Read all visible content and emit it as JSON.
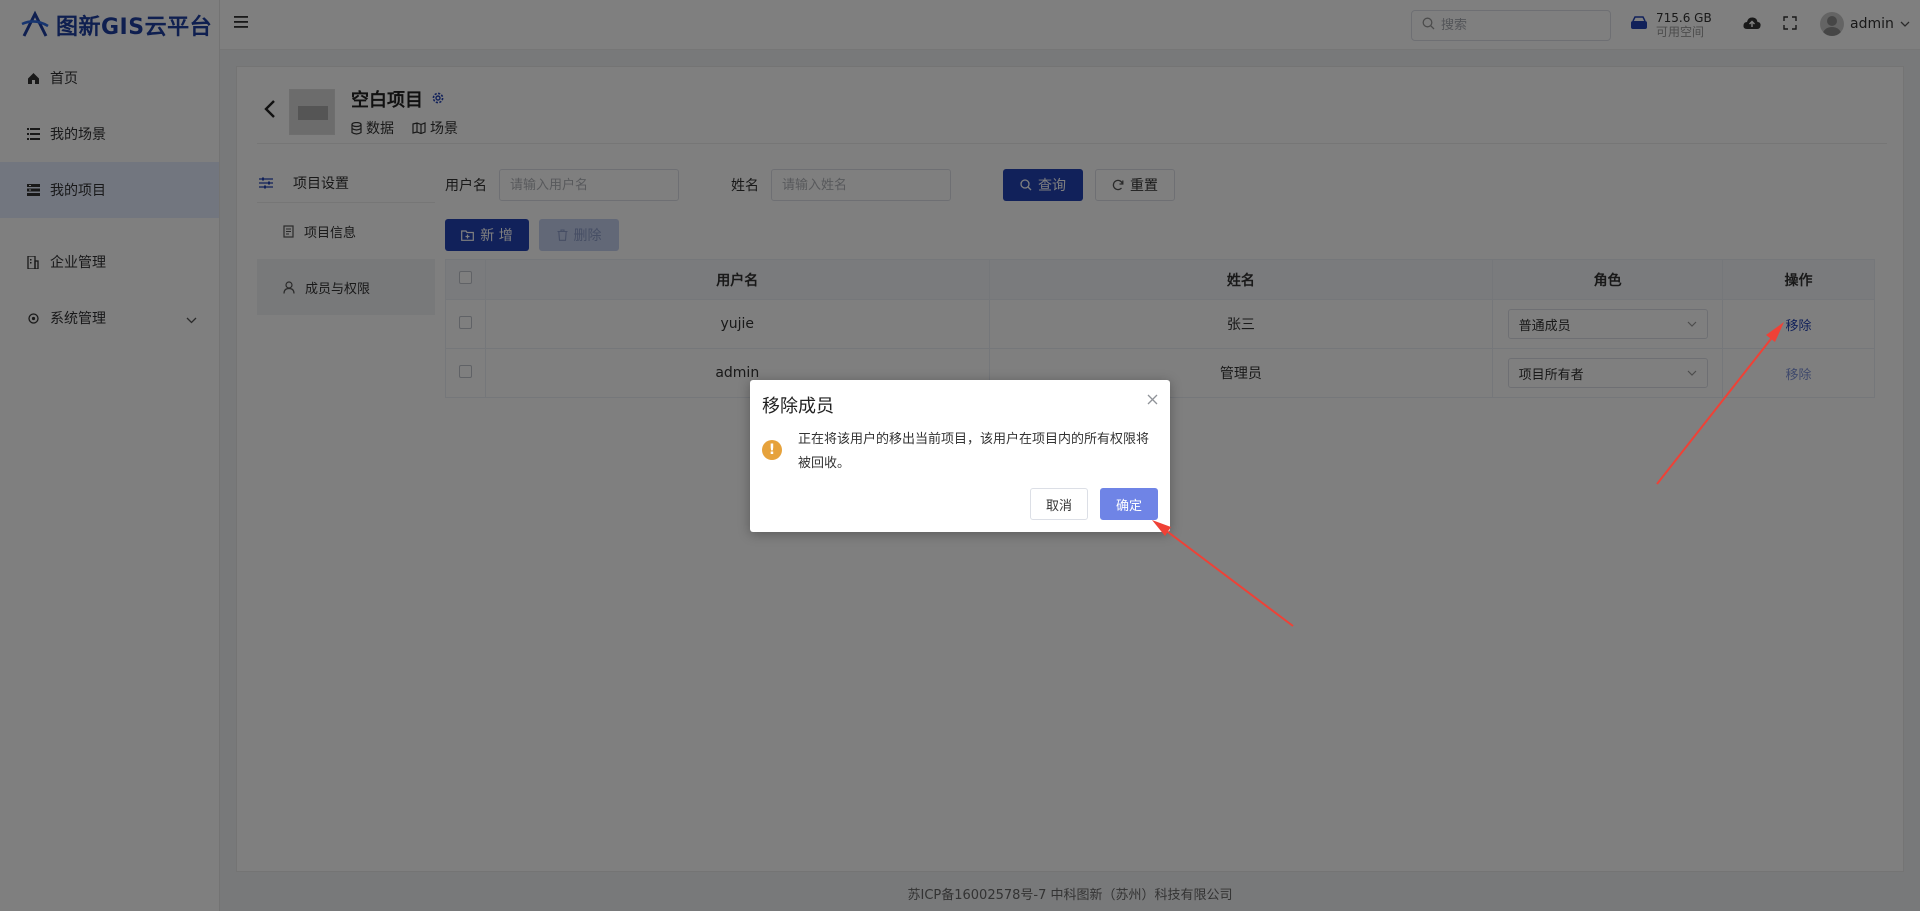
{
  "app": {
    "logo_text": "图新GIS云平台"
  },
  "sidebar": {
    "items": [
      {
        "label": "首页",
        "icon": "home-icon"
      },
      {
        "label": "我的场景",
        "icon": "list-icon"
      },
      {
        "label": "我的项目",
        "icon": "project-icon",
        "active": true
      },
      {
        "label": "企业管理",
        "icon": "building-icon"
      },
      {
        "label": "系统管理",
        "icon": "settings-icon",
        "has_children": true
      }
    ]
  },
  "header": {
    "search_placeholder": "搜索",
    "storage_value": "715.6 GB",
    "storage_label": "可用空间",
    "user_name": "admin"
  },
  "project": {
    "title": "空白项目",
    "link_data": "数据",
    "link_scene": "场景"
  },
  "subnav": {
    "header": "项目设置",
    "items": [
      {
        "label": "项目信息"
      },
      {
        "label": "成员与权限",
        "active": true
      }
    ]
  },
  "filters": {
    "username_label": "用户名",
    "username_placeholder": "请输入用户名",
    "name_label": "姓名",
    "name_placeholder": "请输入姓名",
    "query_label": "查询",
    "reset_label": "重置"
  },
  "actions": {
    "add_label": "新 增",
    "delete_label": "删除"
  },
  "table": {
    "headers": [
      "用户名",
      "姓名",
      "角色",
      "操作"
    ],
    "rows": [
      {
        "username": "yujie",
        "name": "张三",
        "role": "普通成员",
        "action": "移除"
      },
      {
        "username": "admin",
        "name": "管理员",
        "role": "项目所有者",
        "action": "移除"
      }
    ]
  },
  "footer": {
    "text": "苏ICP备16002578号-7 中科图新（苏州）科技有限公司"
  },
  "dialog": {
    "title": "移除成员",
    "message": "正在将该用户的移出当前项目，该用户在项目内的所有权限将被回收。",
    "cancel_label": "取消",
    "confirm_label": "确定"
  },
  "colors": {
    "primary": "#2342b5",
    "warning": "#e6a23c",
    "annotation": "#ef4136"
  }
}
